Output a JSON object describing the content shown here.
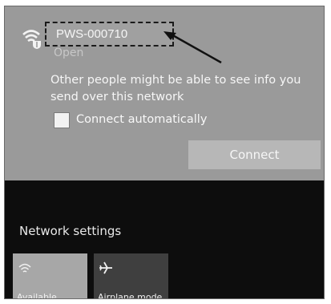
{
  "wifi": {
    "network_name": "PWS-000710",
    "status": "Open",
    "warning": "Other people might be able to see info you send over this network",
    "auto_connect_label": "Connect automatically",
    "auto_connect_checked": false,
    "connect_label": "Connect"
  },
  "network_settings": {
    "label": "Network settings"
  },
  "quick_actions": [
    {
      "label": "Available",
      "icon": "wifi-icon"
    },
    {
      "label": "Airplane mode",
      "icon": "airplane-icon"
    }
  ],
  "colors": {
    "card_bg": "#9a9a9a",
    "panel_bg": "#0d0d0d",
    "button_bg": "#b7b7b7"
  }
}
